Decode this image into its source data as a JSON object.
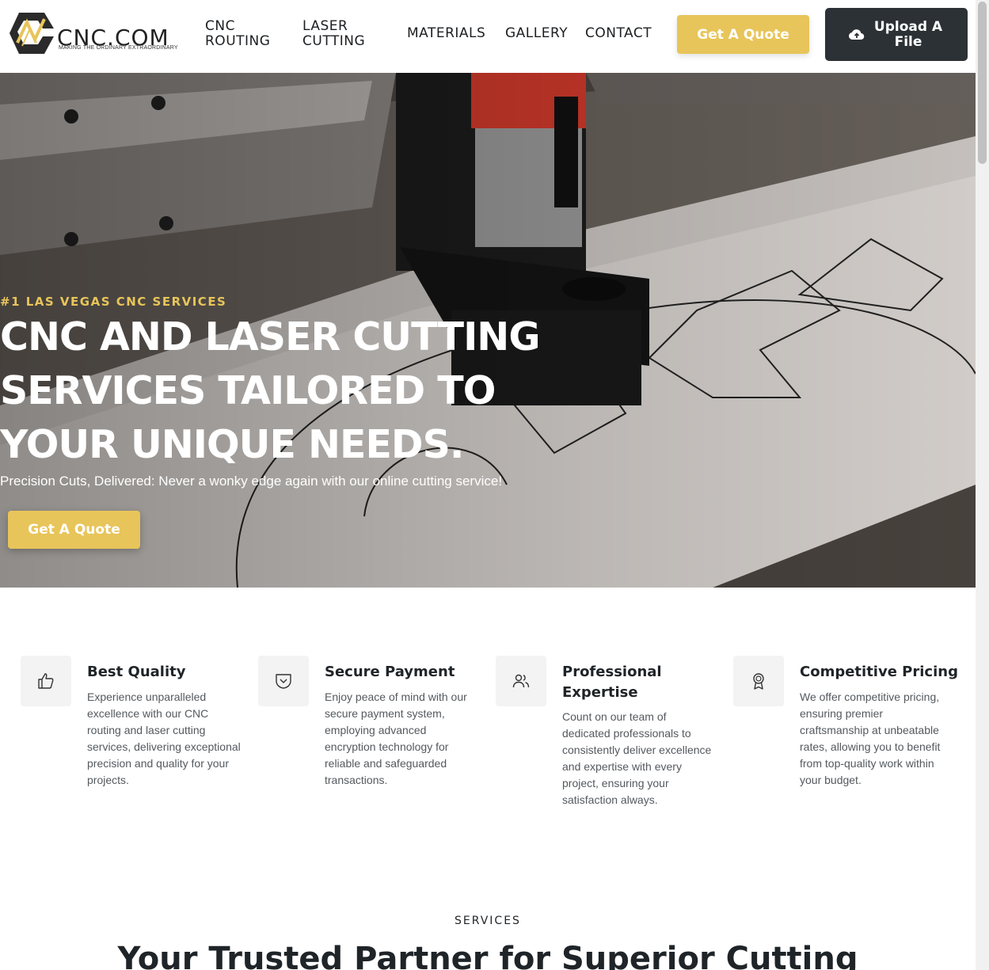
{
  "header": {
    "logo_text": "CNC.COM",
    "logo_tagline": "MAKING THE ORDINARY EXTRAORDINARY",
    "nav": [
      {
        "label": "CNC ROUTING"
      },
      {
        "label": "LASER CUTTING"
      },
      {
        "label": "MATERIALS"
      },
      {
        "label": "GALLERY"
      },
      {
        "label": "CONTACT"
      }
    ],
    "quote_button": "Get A Quote",
    "upload_button": "Upload A File",
    "upload_icon": "cloud-upload-icon"
  },
  "hero": {
    "kicker": "#1 LAS VEGAS CNC SERVICES",
    "title": "CNC AND LASER CUTTING SERVICES TAILORED TO YOUR UNIQUE NEEDS.",
    "subtitle": "Precision Cuts, Delivered: Never a wonky edge again with our online cutting service!",
    "quote_button": "Get A Quote"
  },
  "features": [
    {
      "icon": "thumbs-up-icon",
      "title": "Best Quality",
      "text": "Experience unparalleled excellence with our CNC routing and laser cutting services, delivering exceptional precision and quality for your projects."
    },
    {
      "icon": "shield-check-icon",
      "title": "Secure Payment",
      "text": "Enjoy peace of mind with our secure payment system, employing advanced encryption technology for reliable and safeguarded transactions."
    },
    {
      "icon": "users-icon",
      "title": "Professional Expertise",
      "text": "Count on our team of dedicated professionals to consistently deliver excellence and expertise with every project, ensuring your satisfaction always."
    },
    {
      "icon": "award-icon",
      "title": "Competitive Pricing",
      "text": "We offer competitive pricing, ensuring premier craftsmanship at unbeatable rates, allowing you to benefit from top-quality work within your budget."
    }
  ],
  "services": {
    "label": "SERVICES",
    "heading": "Your Trusted Partner for Superior Cutting"
  },
  "colors": {
    "accent": "#e8c55a",
    "dark": "#2b3135",
    "text": "#1f2428"
  }
}
